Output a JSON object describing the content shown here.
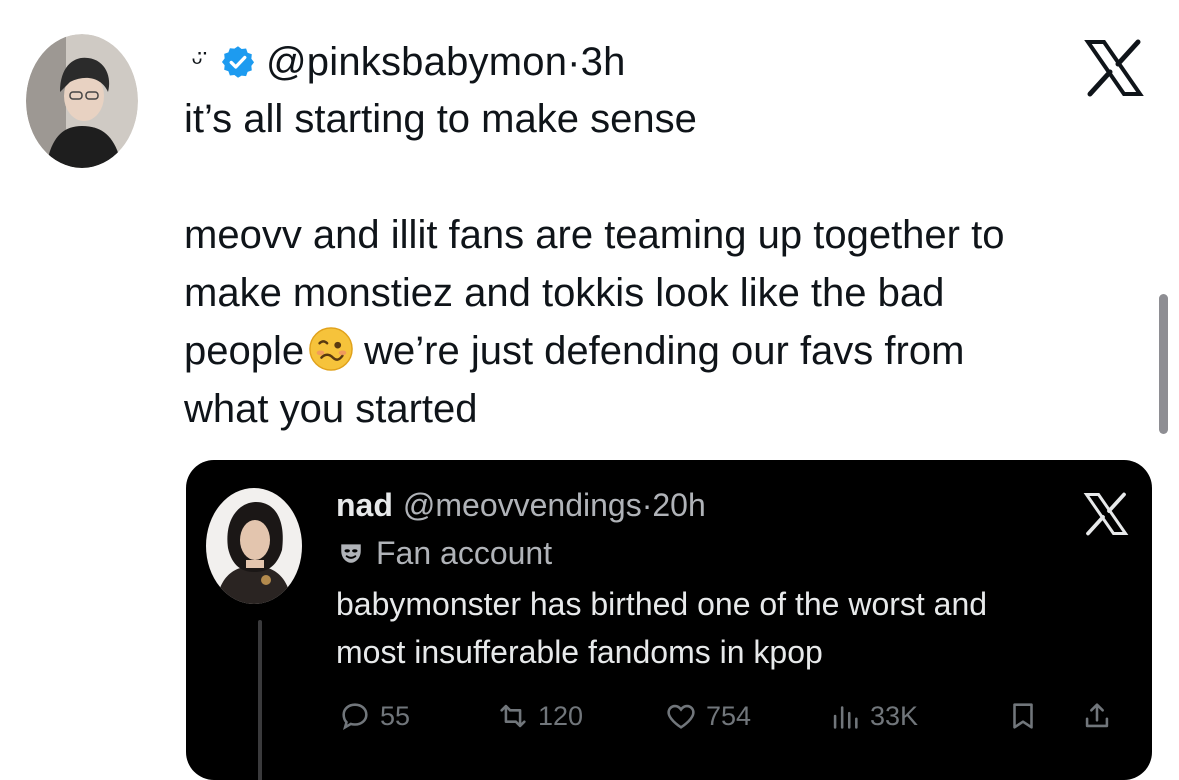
{
  "tweet": {
    "avatar_icon": "user-avatar",
    "smile_icon": "smiley-icon",
    "verified_icon": "verified-badge-icon",
    "handle": "@pinksbabymon",
    "time": "·3h",
    "text_lines": [
      "it’s all starting to make sense",
      "",
      "meovv and illit fans are teaming up together to",
      "make monstiez and tokkis look like the bad",
      "people",
      "we’re just defending our favs from",
      "what you started"
    ],
    "emoji": "woozy-face",
    "logo": "x-logo"
  },
  "quoted": {
    "name": "nad",
    "handle": "@meovvendings",
    "time": "·20h",
    "label": "Fan account",
    "label_icon": "mask-icon",
    "text_lines": [
      "babymonster has birthed one of the worst and",
      "most insufferable fandoms in kpop"
    ],
    "actions": {
      "replies": "55",
      "reposts": "120",
      "likes": "754",
      "views": "33K"
    }
  },
  "colors": {
    "verified": "#1d9bf0",
    "quote_bg": "#000000",
    "muted": "#71767b"
  }
}
